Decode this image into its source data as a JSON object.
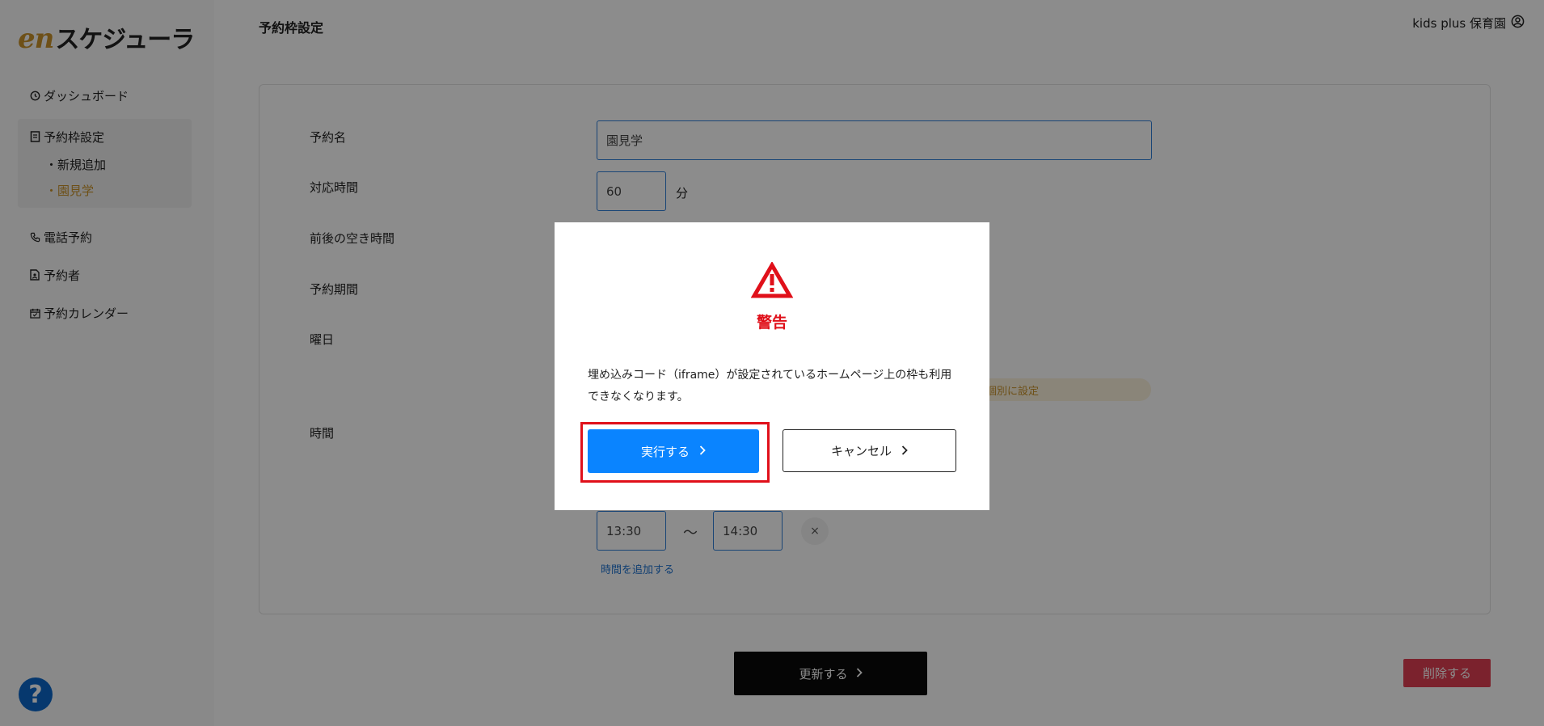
{
  "logo": {
    "en": "en",
    "text": "スケジューラ"
  },
  "sidebar": {
    "items": [
      {
        "label": "ダッシュボード"
      },
      {
        "label": "予約枠設定",
        "children": [
          "・新規追加",
          "・園見学"
        ]
      },
      {
        "label": "電話予約"
      },
      {
        "label": "予約者"
      },
      {
        "label": "予約カレンダー"
      }
    ],
    "help": "?"
  },
  "header": {
    "title": "予約枠設定",
    "user": "kids plus 保育園"
  },
  "form": {
    "labels": {
      "name": "予約名",
      "duration": "対応時間",
      "buffer": "前後の空き時間",
      "period": "予約期間",
      "weekday": "曜日",
      "time": "時間"
    },
    "name_value": "園見学",
    "duration_value": "60",
    "duration_unit": "分",
    "weekday_individual": "個別に設定",
    "time_start": "13:30",
    "tilde": "〜",
    "time_end": "14:30",
    "remove": "×",
    "add_time": "時間を追加する"
  },
  "footer": {
    "update": "更新する",
    "delete": "削除する"
  },
  "modal": {
    "title": "警告",
    "message": "埋め込みコード（iframe）が設定されているホームページ上の枠も利用できなくなります。",
    "execute": "実行する",
    "cancel": "キャンセル"
  },
  "colors": {
    "accent": "#c8922a",
    "primary": "#0a84ff",
    "danger": "#e03e52",
    "warning": "#e0101a"
  }
}
